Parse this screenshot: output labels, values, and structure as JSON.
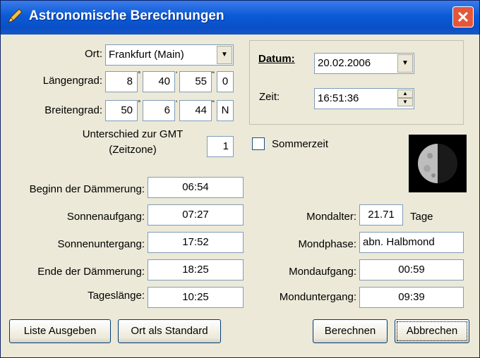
{
  "window": {
    "title": "Astronomische Berechnungen",
    "close_label": "✕"
  },
  "location": {
    "ort_label": "Ort:",
    "ort_value": "Frankfurt (Main)",
    "laengengrad_label": "Längengrad:",
    "laengengrad": [
      "8",
      "40",
      "55",
      "0"
    ],
    "breitengrad_label": "Breitengrad:",
    "breitengrad": [
      "50",
      "6",
      "44",
      "N"
    ],
    "degree_marks": [
      "°",
      "'",
      "\""
    ],
    "gmt_label_line1": "Unterschied zur GMT",
    "gmt_label_line2": "(Zeitzone)",
    "gmt_value": "1"
  },
  "datetime": {
    "datum_label": "Datum:",
    "datum_value": "20.02.2006",
    "zeit_label": "Zeit:",
    "zeit_value": "16:51:36",
    "sommerzeit_label": "Sommerzeit"
  },
  "sun": {
    "rows": [
      {
        "label": "Beginn der Dämmerung:",
        "value": "06:54"
      },
      {
        "label": "Sonnenaufgang:",
        "value": "07:27"
      },
      {
        "label": "Sonnenuntergang:",
        "value": "17:52"
      },
      {
        "label": "Ende der Dämmerung:",
        "value": "18:25"
      },
      {
        "label": "Tageslänge:",
        "value": "10:25"
      }
    ]
  },
  "moon": {
    "mondalter_label": "Mondalter:",
    "mondalter_value": "21.71",
    "mondalter_unit": "Tage",
    "mondphase_label": "Mondphase:",
    "mondphase_value": "abn. Halbmond",
    "mondaufgang_label": "Mondaufgang:",
    "mondaufgang_value": "00:59",
    "monduntergang_label": "Monduntergang:",
    "monduntergang_value": "09:39"
  },
  "buttons": {
    "liste": "Liste Ausgeben",
    "standard": "Ort als Standard",
    "berechnen": "Berechnen",
    "abbrechen": "Abbrechen"
  }
}
